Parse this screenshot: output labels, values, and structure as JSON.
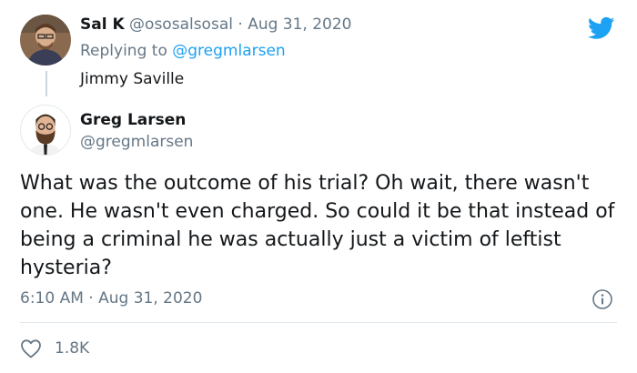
{
  "parent_tweet": {
    "author_name": "Sal K",
    "author_handle": "@ososalsosal",
    "separator": "·",
    "date": "Aug 31, 2020",
    "replying_prefix": "Replying to",
    "replying_handle": "@gregmlarsen",
    "text": "Jimmy Saville"
  },
  "main_tweet": {
    "author_name": "Greg Larsen",
    "author_handle": "@gregmlarsen",
    "text": "What was the outcome of his trial? Oh wait, there wasn't one. He wasn't even charged. So could it be that instead of being a criminal he was actually just a victim of leftist hysteria?",
    "time": "6:10 AM",
    "separator": "·",
    "date": "Aug 31, 2020",
    "likes": "1.8K"
  },
  "icons": {
    "brand": "twitter-bird-icon",
    "info": "info-icon",
    "like": "heart-icon"
  },
  "colors": {
    "brand": "#1da1f2",
    "secondary_text": "#657786",
    "divider": "#e1e8ed"
  }
}
